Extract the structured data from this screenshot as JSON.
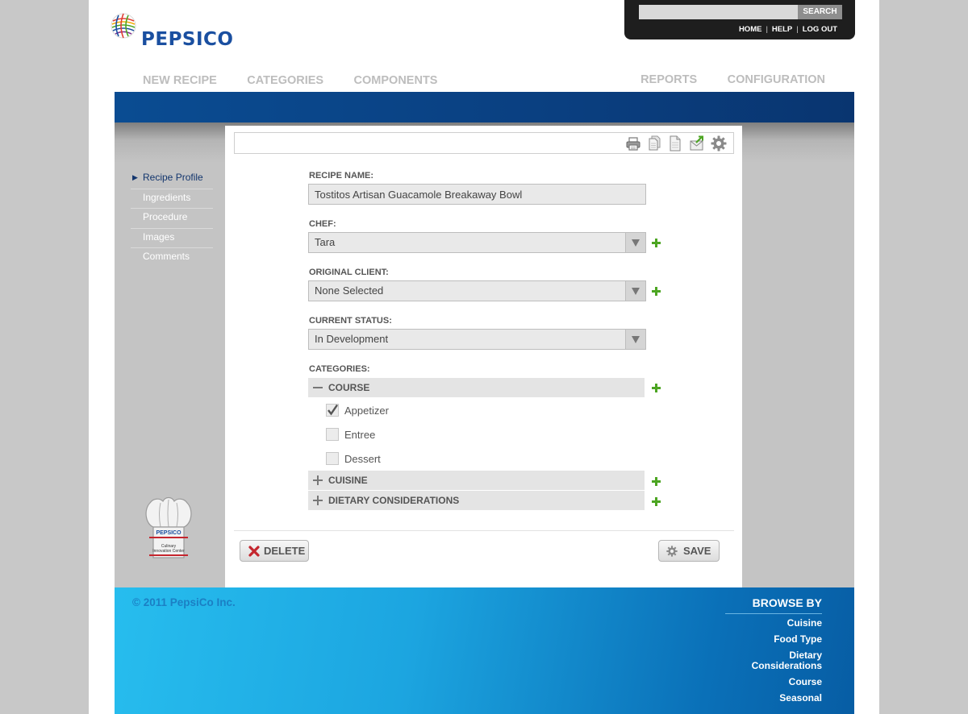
{
  "header": {
    "logo_text": "PEPSICO",
    "search": {
      "placeholder": "",
      "button_label": "SEARCH"
    },
    "top_links": [
      "HOME",
      "HELP",
      "LOG OUT"
    ]
  },
  "main_nav": {
    "left": [
      "NEW RECIPE",
      "CATEGORIES",
      "COMPONENTS"
    ],
    "right": [
      "REPORTS",
      "CONFIGURATION"
    ]
  },
  "subnav": {
    "items": [
      {
        "label": "Recipe Profile",
        "active": true
      },
      {
        "label": "Ingredients",
        "active": false
      },
      {
        "label": "Procedure",
        "active": false
      },
      {
        "label": "Images",
        "active": false
      },
      {
        "label": "Comments",
        "active": false
      }
    ]
  },
  "branding": {
    "hat_brand": "PEPSICO",
    "hat_line1": "Culinary",
    "hat_line2": "Innovation Center"
  },
  "toolbar": {
    "icons": [
      "print-icon",
      "copy-icon",
      "document-icon",
      "email-export-icon",
      "settings-gear-icon"
    ]
  },
  "form": {
    "recipe_name": {
      "label": "RECIPE NAME:",
      "value": "Tostitos Artisan Guacamole Breakaway Bowl"
    },
    "chef": {
      "label": "CHEF:",
      "value": "Tara"
    },
    "original_client": {
      "label": "ORIGINAL CLIENT:",
      "value": "None Selected"
    },
    "current_status": {
      "label": "CURRENT STATUS:",
      "value": "In Development"
    },
    "categories": {
      "label": "CATEGORIES:",
      "groups": [
        {
          "name": "COURSE",
          "expanded": true,
          "options": [
            {
              "label": "Appetizer",
              "checked": true
            },
            {
              "label": "Entree",
              "checked": false
            },
            {
              "label": "Dessert",
              "checked": false
            }
          ]
        },
        {
          "name": "CUISINE",
          "expanded": false,
          "options": []
        },
        {
          "name": "DIETARY CONSIDERATIONS",
          "expanded": false,
          "options": []
        }
      ]
    }
  },
  "actions": {
    "delete_label": "DELETE",
    "save_label": "SAVE"
  },
  "footer": {
    "copyright": "© 2011 PepsiCo Inc.",
    "browse_title": "BROWSE BY",
    "browse_links": [
      {
        "lines": [
          "Cuisine"
        ]
      },
      {
        "lines": [
          "Food Type"
        ]
      },
      {
        "lines": [
          "Dietary",
          "Considerations"
        ]
      },
      {
        "lines": [
          "Course"
        ]
      },
      {
        "lines": [
          "Seasonal"
        ]
      }
    ]
  },
  "colors": {
    "brand_blue": "#1a4fa0",
    "nav_blue_bar": "#0a4c92",
    "plus_green": "#4ca522",
    "delete_red": "#c4262e",
    "footer_cyan": "#27bdee"
  }
}
